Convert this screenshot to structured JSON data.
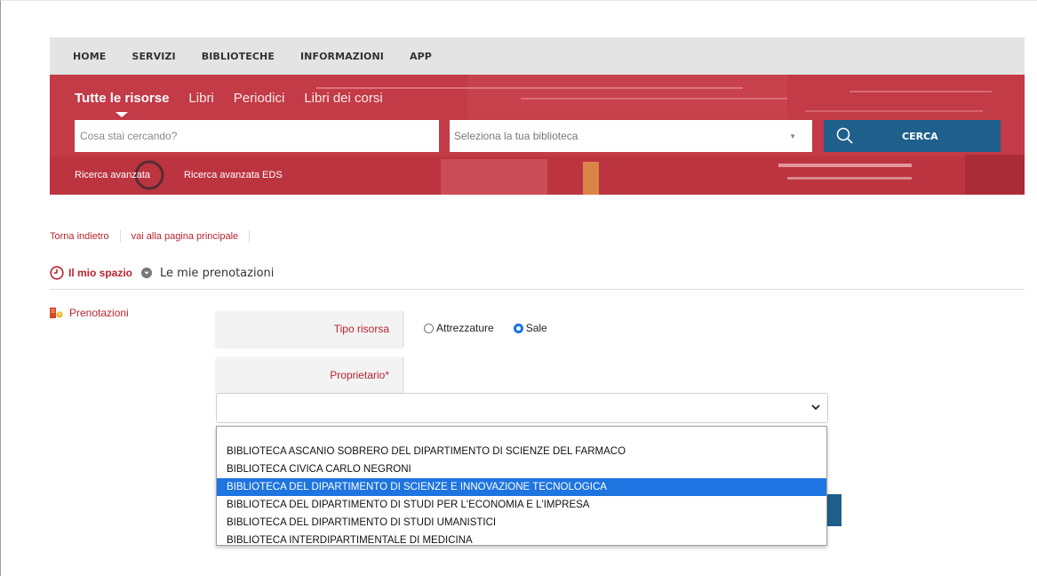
{
  "topnav": {
    "items": [
      "HOME",
      "SERVIZI",
      "BIBLIOTECHE",
      "INFORMAZIONI",
      "APP"
    ]
  },
  "search": {
    "tabs": [
      "Tutte le risorse",
      "Libri",
      "Periodici",
      "Libri dei corsi"
    ],
    "active_tab": "Tutte le risorse",
    "input_placeholder": "Cosa stai cercando?",
    "library_select_value": "Seleziona la tua biblioteca",
    "button_label": "CERCA",
    "advanced_search": "Ricerca avanzata",
    "advanced_search_eds": "Ricerca avanzata EDS"
  },
  "breadcrumb": {
    "back": "Torna indietro",
    "home": "vai alla pagina principale"
  },
  "section": {
    "my_space": "Il mio spazio",
    "current": "Le mie prenotazioni"
  },
  "sidebar": {
    "items": [
      {
        "label": "Prenotazioni",
        "icon": "reservations-icon"
      }
    ]
  },
  "form": {
    "resource_type_label": "Tipo risorsa",
    "resource_options": [
      {
        "label": "Attrezzature",
        "checked": false
      },
      {
        "label": "Sale",
        "checked": true
      }
    ],
    "owner_label": "Proprietario*",
    "owner_value": "",
    "owner_options": [
      "BIBLIOTECA ASCANIO SOBRERO DEL DIPARTIMENTO DI SCIENZE DEL FARMACO",
      "BIBLIOTECA CIVICA CARLO NEGRONI",
      "BIBLIOTECA DEL DIPARTIMENTO DI SCIENZE E INNOVAZIONE TECNOLOGICA",
      "BIBLIOTECA DEL DIPARTIMENTO DI STUDI PER L'ECONOMIA E L'IMPRESA",
      "BIBLIOTECA DEL DIPARTIMENTO DI STUDI UMANISTICI",
      "BIBLIOTECA INTERDIPARTIMENTALE DI MEDICINA"
    ],
    "highlighted_option": "BIBLIOTECA DEL DIPARTIMENTO DI SCIENZE E INNOVAZIONE TECNOLOGICA"
  },
  "colors": {
    "brand_red": "#c23b46",
    "link_red": "#b8242f",
    "search_blue": "#1f5f8b",
    "highlight_blue": "#1e74e0"
  }
}
